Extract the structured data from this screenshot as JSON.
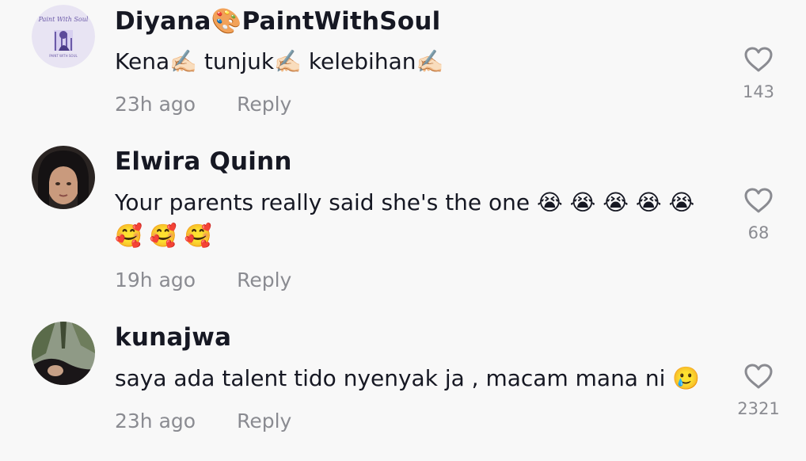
{
  "comments": [
    {
      "username": "Diyana🎨PaintWithSoul",
      "text": "Kena✍🏻 tunjuk✍🏻 kelebihan✍🏻",
      "time": "23h ago",
      "reply": "Reply",
      "likes": "143",
      "avatar_icon": "paintwithsoul-logo-avatar"
    },
    {
      "username": "Elwira Quinn",
      "text_line1": "Your parents really said she's the one 😭 😭 😭 😭 😭",
      "text_line2": "🥰 🥰 🥰",
      "time": "19h ago",
      "reply": "Reply",
      "likes": "68",
      "avatar_icon": "profile-photo-avatar"
    },
    {
      "username": "kunajwa",
      "text": "saya ada talent tido nyenyak ja , macam mana ni 🥲",
      "time": "23h ago",
      "reply": "Reply",
      "likes": "2321",
      "avatar_icon": "profile-photo-avatar"
    }
  ],
  "colors": {
    "background": "#f8f8f8",
    "username": "#161823",
    "meta": "#8a8b91",
    "heart_outline": "#8a8b91"
  }
}
